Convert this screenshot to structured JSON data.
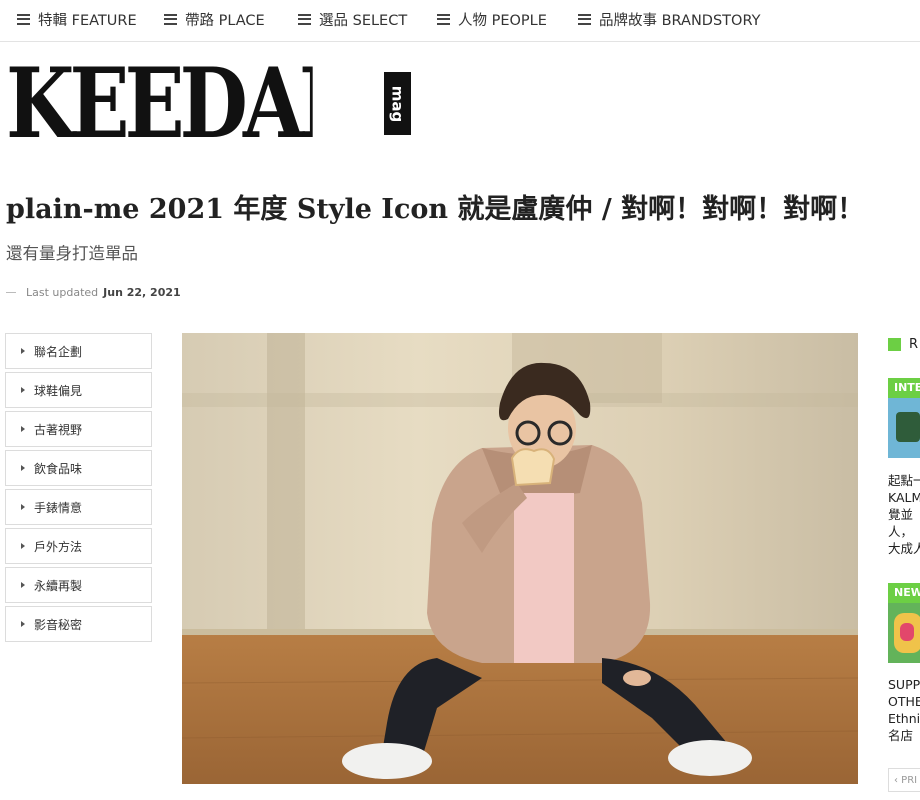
{
  "nav": {
    "items": [
      {
        "label": "特輯 FEATURE"
      },
      {
        "label": "帶路 PLACE"
      },
      {
        "label": "選品 SELECT"
      },
      {
        "label": "人物 PEOPLE"
      },
      {
        "label": "品牌故事 BRANDSTORY"
      }
    ]
  },
  "logo": {
    "word": "KEEDAN",
    "suffix": "mag"
  },
  "article": {
    "title": "plain-me 2021 年度 Style Icon 就是盧廣仲 / 對啊！對啊！對啊！",
    "subtitle": "還有量身打造單品",
    "meta_label": "Last updated",
    "meta_date": "Jun 22, 2021"
  },
  "categories": [
    {
      "label": "聯名企劃"
    },
    {
      "label": "球鞋偏見"
    },
    {
      "label": "古著視野"
    },
    {
      "label": "飲食品味"
    },
    {
      "label": "手錶情意"
    },
    {
      "label": "戶外方法"
    },
    {
      "label": "永續再製"
    },
    {
      "label": "影音秘密"
    }
  ],
  "sidebar": {
    "heading": "R",
    "posts": [
      {
        "badge": "INTE",
        "lines": [
          "起點一",
          "KALM",
          "覺並",
          "人，",
          "大成人"
        ]
      },
      {
        "badge": "NEW",
        "lines": [
          "SUPP",
          "OTHE",
          "Ethni",
          "名店"
        ]
      }
    ],
    "prev_label": "‹ PRI"
  },
  "colors": {
    "accent_green": "#6ccf44",
    "text_dark": "#222222"
  }
}
